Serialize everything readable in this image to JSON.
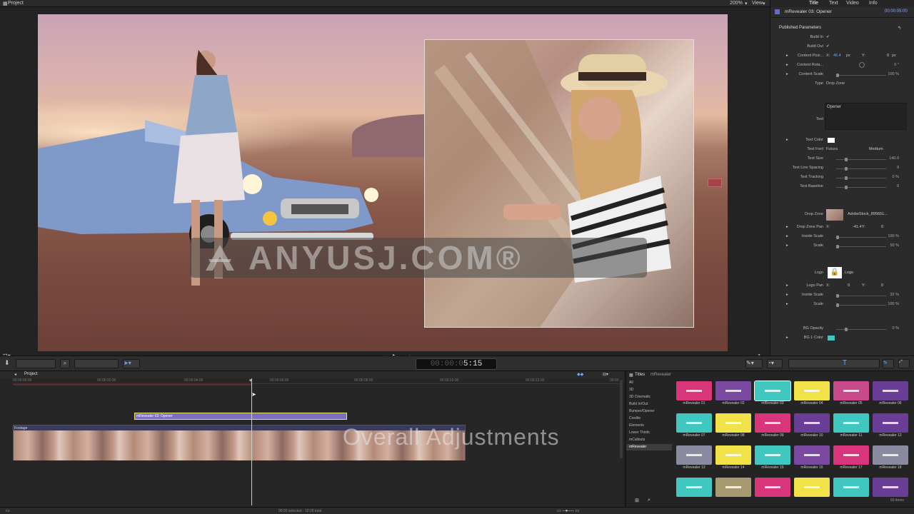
{
  "topbar": {
    "project": "Project",
    "zoom": "200%",
    "view": "View"
  },
  "viewer": {
    "watermark": "ANYUSJ.COM®",
    "overlay_text": "Overall Adjustments"
  },
  "inspector": {
    "tabs": [
      "Title",
      "Text",
      "Video",
      "Info"
    ],
    "clip_name": "mRevealer 03: Opener",
    "duration": "00:00:05:00",
    "section": "Published Parameters",
    "build_in": "Build In",
    "build_out": "Build Out",
    "content_position": "Content Posi...",
    "cp_x_label": "X:",
    "cp_x": "46.4",
    "cp_x_unit": "px",
    "cp_y_label": "Y:",
    "cp_y": "0",
    "cp_y_unit": "px",
    "content_rotation": "Content Rota...",
    "cr_val": "0 °",
    "content_scale": "Content Scale",
    "cs_val": "100 %",
    "type_label": "Type",
    "type_val": "Drop Zone",
    "text_value": "Opener",
    "text_label": "Text",
    "text_color": "Text Color",
    "text_font": "Text Font",
    "font_val": "Futura",
    "font_weight": "Medium",
    "text_size": "Text Size",
    "size_val": "140.0",
    "text_line_spacing": "Text Line Spacing",
    "tls_val": "0",
    "text_tracking": "Text Tracking",
    "tt_val": "0 %",
    "text_baseline": "Text Baseline",
    "tb_val": "0",
    "drop_zone": "Drop Zone",
    "drop_zone_file": "AdobeStock_895651...",
    "drop_zone_pan": "Drop Zone Pan",
    "dzp_x": "-41.4",
    "dzp_y": "0",
    "inside_scale": "Inside Scale",
    "is_val": "100 %",
    "scale": "Scale",
    "scale_val": "50 %",
    "logo": "Logo",
    "logo_val": "Logo",
    "logo_pan": "Logo Pan",
    "lp_x": "0",
    "lp_y": "0",
    "logo_inside_scale": "Inside Scale",
    "lis_val": "32 %",
    "logo_scale": "Scale",
    "ls_val": "100 %",
    "bg_opacity": "BG Opacity",
    "bgo_val": "0 %",
    "bg1_color": "BG 1 Color"
  },
  "toolbar": {
    "timecode": "00:00:05:15",
    "timecode_dim": "00:00:0",
    "timecode_bright": "5:15"
  },
  "timeline": {
    "project": "Project",
    "ruler": [
      "00:00:00:00",
      "00:00:02:00",
      "00:00:04:00",
      "00:00:06:00",
      "00:00:08:00",
      "00:00:10:00",
      "00:00:12:00",
      "00:00"
    ],
    "title_clip": "mRevealer 03: Opener",
    "footage": "Footage"
  },
  "browser": {
    "header": "Titles",
    "filter": "mRevealer",
    "categories": [
      "All",
      "3D",
      "3D Cinematic",
      "Build In/Out",
      "Bumper/Opener",
      "Credits",
      "Elements",
      "Lower Thirds",
      "mCallouts",
      "mRevealer"
    ],
    "tiles": [
      {
        "label": "mRevealer 01",
        "color": "#d9357a"
      },
      {
        "label": "mRevealer 02",
        "color": "#7a4aa0"
      },
      {
        "label": "mRevealer 03",
        "color": "#3fc7c0"
      },
      {
        "label": "mRevealer 04",
        "color": "#f2e24a"
      },
      {
        "label": "mRevealer 05",
        "color": "#c84a8a"
      },
      {
        "label": "mRevealer 06",
        "color": "#6a3e96"
      },
      {
        "label": "mRevealer 07",
        "color": "#3fc7c0"
      },
      {
        "label": "mRevealer 08",
        "color": "#f2e24a"
      },
      {
        "label": "mRevealer 09",
        "color": "#d9357a"
      },
      {
        "label": "mRevealer 10",
        "color": "#6a3e96"
      },
      {
        "label": "mRevealer 11",
        "color": "#3fc7c0"
      },
      {
        "label": "mRevealer 12",
        "color": "#6a3e96"
      },
      {
        "label": "mRevealer 13",
        "color": "#8a8aa0"
      },
      {
        "label": "mRevealer 14",
        "color": "#f2e24a"
      },
      {
        "label": "mRevealer 15",
        "color": "#3fc7c0"
      },
      {
        "label": "mRevealer 16",
        "color": "#7a4aa0"
      },
      {
        "label": "mRevealer 17",
        "color": "#d9357a"
      },
      {
        "label": "mRevealer 18",
        "color": "#8a8aa0"
      },
      {
        "label": "",
        "color": "#3fc7c0"
      },
      {
        "label": "",
        "color": "#a89a70"
      },
      {
        "label": "",
        "color": "#d9357a"
      },
      {
        "label": "",
        "color": "#f2e24a"
      },
      {
        "label": "",
        "color": "#3fc7c0"
      },
      {
        "label": "",
        "color": "#6a3e96"
      }
    ],
    "count": "50 items"
  },
  "status": {
    "selection": "00:00 selected - 10:16 total"
  }
}
